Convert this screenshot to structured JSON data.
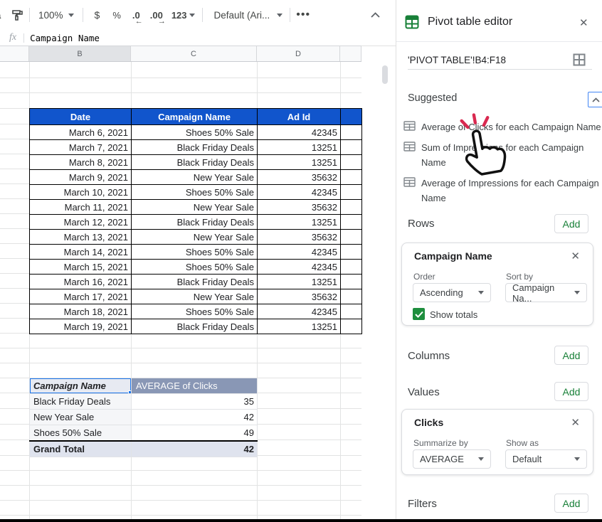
{
  "toolbar": {
    "zoom_value": "100%",
    "currency": "$",
    "percent": "%",
    "decrease_decimal": ".0",
    "decrease_arrow": "←",
    "increase_decimal": ".00",
    "increase_arrow": "→",
    "more_formats": "123",
    "font_value": "Default (Ari...",
    "more_dots": "•••",
    "clipped_fragment": "a"
  },
  "formula_bar": {
    "fx_label": "fx",
    "value": "Campaign Name"
  },
  "grid": {
    "column_headers": [
      "",
      "B",
      "C",
      "D",
      ""
    ],
    "source_table": {
      "headers": [
        "Date",
        "Campaign Name",
        "Ad Id",
        ""
      ],
      "rows": [
        [
          "March 6, 2021",
          "Shoes 50% Sale",
          "42345",
          ""
        ],
        [
          "March 7, 2021",
          "Black Friday Deals",
          "13251",
          ""
        ],
        [
          "March 8, 2021",
          "Black Friday Deals",
          "13251",
          ""
        ],
        [
          "March 9, 2021",
          "New Year Sale",
          "35632",
          ""
        ],
        [
          "March 10, 2021",
          "Shoes 50% Sale",
          "42345",
          ""
        ],
        [
          "March 11, 2021",
          "New Year Sale",
          "35632",
          ""
        ],
        [
          "March 12, 2021",
          "Black Friday Deals",
          "13251",
          ""
        ],
        [
          "March 13, 2021",
          "New Year Sale",
          "35632",
          ""
        ],
        [
          "March 14, 2021",
          "Shoes 50% Sale",
          "42345",
          ""
        ],
        [
          "March 15, 2021",
          "Shoes 50% Sale",
          "42345",
          ""
        ],
        [
          "March 16, 2021",
          "Black Friday Deals",
          "13251",
          ""
        ],
        [
          "March 17, 2021",
          "New Year Sale",
          "35632",
          ""
        ],
        [
          "March 18, 2021",
          "Shoes 50% Sale",
          "42345",
          ""
        ],
        [
          "March 19, 2021",
          "Black Friday Deals",
          "13251",
          ""
        ]
      ]
    },
    "pivot_table": {
      "header_row_label": "Campaign Name",
      "header_value_label": "AVERAGE of Clicks",
      "rows": [
        [
          "Black Friday Deals",
          "35"
        ],
        [
          "New Year Sale",
          "42"
        ],
        [
          "Shoes 50% Sale",
          "49"
        ]
      ],
      "grand_total_label": "Grand Total",
      "grand_total_value": "42"
    }
  },
  "panel": {
    "title": "Pivot table editor",
    "close_label": "✕",
    "range_value": "'PIVOT TABLE'!B4:F18",
    "suggested": {
      "label": "Suggested",
      "items": [
        "Average of Clicks for each Campaign Name",
        "Sum of Impressions for each Campaign Name",
        "Average of Impressions for each Campaign Name"
      ]
    },
    "rows_section": {
      "label": "Rows",
      "add_label": "Add",
      "card": {
        "title": "Campaign Name",
        "close_label": "✕",
        "order_label": "Order",
        "order_value": "Ascending",
        "sort_label": "Sort by",
        "sort_value": "Campaign Na...",
        "show_totals_label": "Show totals"
      }
    },
    "columns_section": {
      "label": "Columns",
      "add_label": "Add"
    },
    "values_section": {
      "label": "Values",
      "add_label": "Add",
      "card": {
        "title": "Clicks",
        "close_label": "✕",
        "summarize_label": "Summarize by",
        "summarize_value": "AVERAGE",
        "show_as_label": "Show as",
        "show_as_value": "Default"
      }
    },
    "filters_section": {
      "label": "Filters",
      "add_label": "Add"
    }
  },
  "colors": {
    "table_header_blue": "#1155cc",
    "pivot_header_slate": "#8997b5",
    "grand_total_bg": "#dfe3ee",
    "selection_blue": "#1a73e8",
    "google_green": "#188038",
    "checkbox_green": "#1e8e3e",
    "click_ray_red": "#d9295055"
  }
}
